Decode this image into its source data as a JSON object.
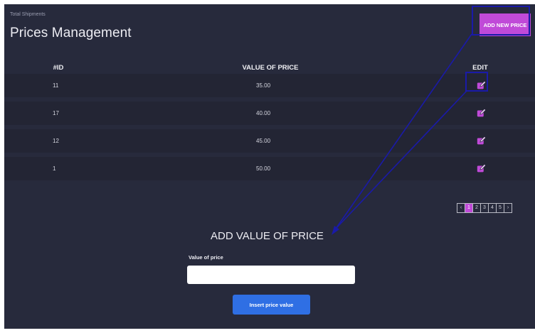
{
  "header": {
    "subtitle": "Total Shipments",
    "title": "Prices Management",
    "add_button_label": "ADD NEW PRICE"
  },
  "table": {
    "columns": [
      "#ID",
      "VALUE OF PRICE",
      "EDIT"
    ],
    "rows": [
      {
        "id": "11",
        "value": "35.00"
      },
      {
        "id": "17",
        "value": "40.00"
      },
      {
        "id": "12",
        "value": "45.00"
      },
      {
        "id": "1",
        "value": "50.00"
      }
    ],
    "edit_icon": "edit-icon"
  },
  "pagination": {
    "prev": "‹",
    "pages": [
      "1",
      "2",
      "3",
      "4",
      "5"
    ],
    "next": "›",
    "active_page": "1"
  },
  "form": {
    "title": "ADD VALUE OF PRICE",
    "field_label": "Value of price",
    "field_value": "",
    "field_placeholder": "",
    "submit_label": "Insert price value"
  },
  "colors": {
    "background": "#272a3c",
    "row": "#232534",
    "accent": "#c04ad8",
    "primary": "#2f6fe4",
    "annotation": "#1a1aa8"
  }
}
